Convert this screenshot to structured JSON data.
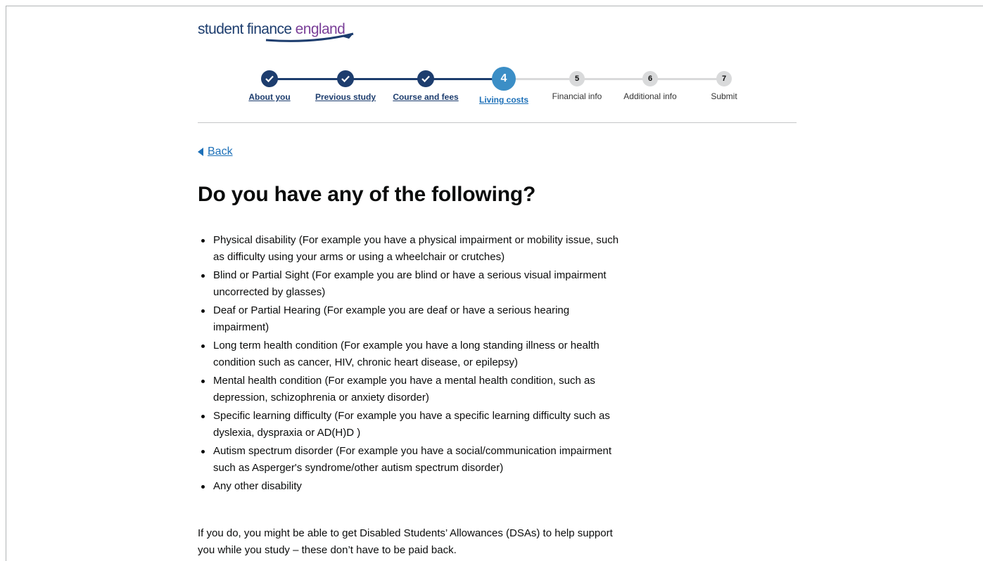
{
  "logo": {
    "part1": "student finance ",
    "part2": "england"
  },
  "steps": [
    {
      "num": "",
      "label": "About you",
      "state": "done"
    },
    {
      "num": "",
      "label": "Previous study",
      "state": "done"
    },
    {
      "num": "",
      "label": "Course and fees",
      "state": "done"
    },
    {
      "num": "4",
      "label": "Living costs",
      "state": "current"
    },
    {
      "num": "5",
      "label": "Financial info",
      "state": "todo"
    },
    {
      "num": "6",
      "label": "Additional info",
      "state": "todo"
    },
    {
      "num": "7",
      "label": "Submit",
      "state": "todo"
    }
  ],
  "back": {
    "label": "Back"
  },
  "page_title": "Do you have any of the following?",
  "conditions": [
    "Physical disability (For example you have a physical impairment or mobility issue, such as difficulty using your arms or using a wheelchair or crutches)",
    "Blind or Partial Sight (For example you are blind or have a serious visual impairment uncorrected by glasses)",
    "Deaf or Partial Hearing (For example you are deaf or have a serious hearing impairment)",
    "Long term health condition (For example you have a long standing illness or health condition such as cancer, HIV, chronic heart disease, or epilepsy)",
    "Mental health condition (For example you have a mental health condition, such as depression, schizophrenia or anxiety disorder)",
    "Specific learning difficulty (For example you have a specific learning difficulty such as dyslexia, dyspraxia or AD(H)D )",
    "Autism spectrum disorder (For example you have a social/communication impairment such as Asperger's syndrome/other autism spectrum disorder)",
    "Any other disability"
  ],
  "dsa_text": "If you do, you might be able to get Disabled Students’ Allowances (DSAs) to help support you while you study – these don’t have to be paid back.",
  "colors": {
    "brand_navy": "#1d3d6e",
    "current_step": "#3b8ec6",
    "link": "#1d70b8",
    "pending": "#d9dadb"
  }
}
